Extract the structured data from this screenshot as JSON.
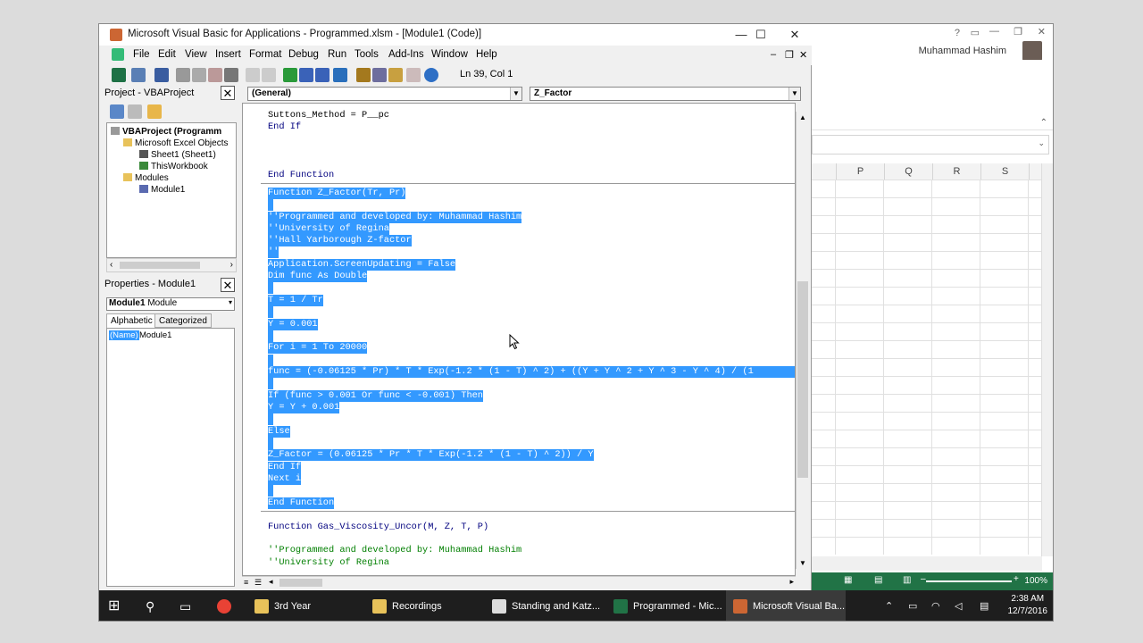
{
  "vba": {
    "title": "Microsoft Visual Basic for Applications - Programmed.xlsm - [Module1 (Code)]",
    "window_buttons": [
      "—",
      "☐",
      "✕"
    ],
    "menu": [
      {
        "label": "File"
      },
      {
        "label": "Edit"
      },
      {
        "label": "View"
      },
      {
        "label": "Insert"
      },
      {
        "label": "Format"
      },
      {
        "label": "Debug"
      },
      {
        "label": "Run"
      },
      {
        "label": "Tools"
      },
      {
        "label": "Add-Ins"
      },
      {
        "label": "Window"
      },
      {
        "label": "Help"
      }
    ],
    "status_position": "Ln 39, Col 1",
    "project_pane": {
      "title": "Project - VBAProject",
      "tree": [
        "VBAProject (Programm",
        "Microsoft Excel Objects",
        "Sheet1 (Sheet1)",
        "ThisWorkbook",
        "Modules",
        "Module1"
      ]
    },
    "properties_pane": {
      "title": "Properties - Module1",
      "object_name": "Module1",
      "object_type": "Module",
      "tabs": [
        "Alphabetic",
        "Categorized"
      ],
      "rows": [
        {
          "name": "(Name)",
          "value": "Module1"
        }
      ]
    },
    "combo_general": "(General)",
    "combo_procedure": "Z_Factor",
    "code": {
      "block_top": [
        "Suttons_Method = P__pc",
        "End If",
        "",
        "",
        "End Function"
      ],
      "selected": [
        "Function Z_Factor(Tr, Pr)",
        "",
        "''Programmed and developed by: Muhammad Hashim",
        "''University of Regina",
        "''Hall Yarborough Z-factor",
        "''",
        "Application.ScreenUpdating = False",
        "Dim func As Double",
        "",
        "T = 1 / Tr",
        "",
        "Y = 0.001",
        "",
        "For i = 1 To 20000",
        "",
        "func = (-0.06125 * Pr) * T * Exp(-1.2 * (1 - T) ^ 2) + ((Y + Y ^ 2 + Y ^ 3 - Y ^ 4) / (1",
        "",
        "If (func > 0.001 Or func < -0.001) Then",
        "Y = Y + 0.001",
        "",
        "Else",
        "",
        "Z_Factor = (0.06125 * Pr * T * Exp(-1.2 * (1 - T) ^ 2)) / Y",
        "End If",
        "Next i",
        "",
        "End Function"
      ],
      "block_bottom": [
        "Function Gas_Viscosity_Uncor(M, Z, T, P)",
        "",
        "''Programmed and developed by: Muhammad Hashim",
        "''University of Regina"
      ]
    }
  },
  "excel": {
    "user": "Muhammad Hashim",
    "columns": [
      "P",
      "Q",
      "R",
      "S"
    ],
    "zoom": "100%",
    "status_color": "#217346"
  },
  "taskbar": {
    "items": [
      {
        "label": "3rd Year"
      },
      {
        "label": "Recordings"
      },
      {
        "label": "Standing and Katz..."
      },
      {
        "label": "Programmed - Mic..."
      },
      {
        "label": "Microsoft Visual Ba..."
      }
    ],
    "time": "2:38 AM",
    "date": "12/7/2016"
  }
}
